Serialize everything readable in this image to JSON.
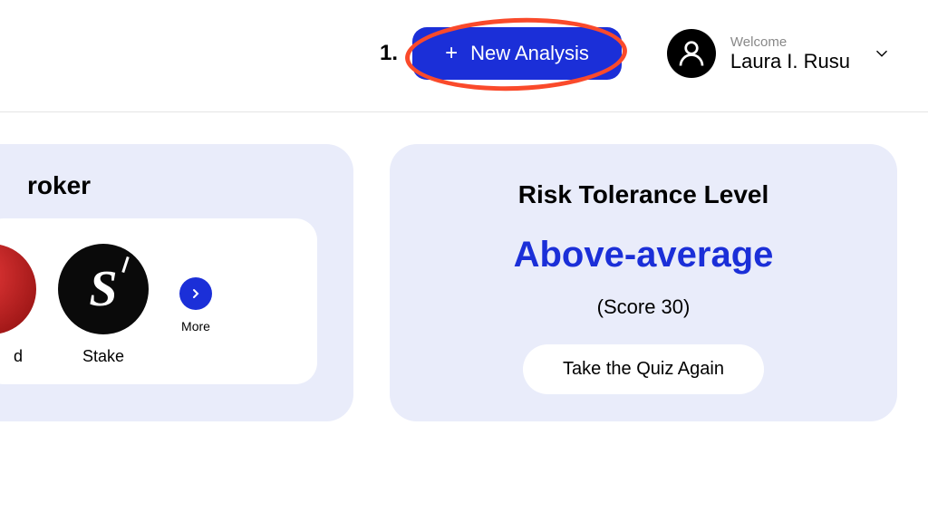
{
  "header": {
    "step_number": "1.",
    "new_analysis_label": "New Analysis",
    "welcome_label": "Welcome",
    "user_name": "Laura I. Rusu"
  },
  "broker": {
    "title_partial": "roker",
    "items": [
      {
        "label_partial": "d",
        "logo": "red"
      },
      {
        "label": "Stake",
        "logo": "stake"
      }
    ],
    "more_label": "More"
  },
  "risk": {
    "title": "Risk Tolerance Level",
    "level": "Above-average",
    "score_text": "(Score 30)",
    "quiz_button": "Take the Quiz Again"
  },
  "colors": {
    "primary_blue": "#1b2fd8",
    "highlight_orange": "#fa4a2b",
    "card_bg": "#e9ecfa"
  }
}
